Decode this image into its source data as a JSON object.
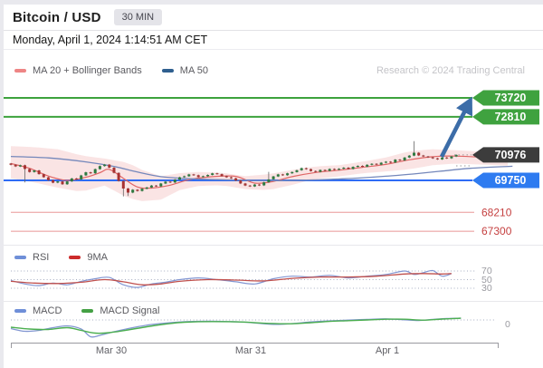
{
  "header": {
    "title": "Bitcoin / USD",
    "timeframe": "30 MIN"
  },
  "subheader": {
    "datetime": "Monday, April 1, 2024 1:14:51 AM CET"
  },
  "watermark": "Research © 2024 Trading Central",
  "colors": {
    "resistance_line": "#3da23d",
    "resistance_badge": "#3fa23f",
    "last_price_badge": "#3c3c3c",
    "support_active_line": "#2e6cf5",
    "support_active_badge": "#2e7bf0",
    "support_minor_line": "#efb3b3",
    "support_minor_text": "#c54040",
    "candle_up": "#2c7a3f",
    "candle_down": "#a83232",
    "ma20": "#e06666",
    "ma50": "#7588bb",
    "bollinger_fill": "#f6caca",
    "rsi_line": "#8296d2",
    "rsi_ma_line": "#c0504d",
    "macd_line": "#8296d2",
    "macd_signal_line": "#4caf50",
    "arrow": "#3c6da8"
  },
  "legends": {
    "main": [
      {
        "label": "MA 20 + Bollinger Bands",
        "color": "#ee8585"
      },
      {
        "label": "MA 50",
        "color": "#2f5f8f"
      }
    ],
    "rsi": [
      {
        "label": "RSI",
        "color": "#6f8fd8"
      },
      {
        "label": "9MA",
        "color": "#cc2b2b"
      }
    ],
    "macd": [
      {
        "label": "MACD",
        "color": "#6f8fd8"
      },
      {
        "label": "MACD Signal",
        "color": "#44a044"
      }
    ]
  },
  "chart_data": [
    {
      "type": "candlestick",
      "title": "Bitcoin / USD 30 MIN",
      "x_ticks": [
        "Mar 30",
        "Mar 31",
        "Apr 1"
      ],
      "y_range_visible": [
        67300,
        73720
      ],
      "levels": [
        {
          "value": 73720,
          "role": "resistance",
          "style": "green-badge"
        },
        {
          "value": 72810,
          "role": "resistance",
          "style": "green-badge"
        },
        {
          "value": 70976,
          "role": "last-price",
          "style": "dark-badge"
        },
        {
          "value": 69750,
          "role": "support",
          "style": "blue-badge"
        },
        {
          "value": 68210,
          "role": "support",
          "style": "red-text"
        },
        {
          "value": 67300,
          "role": "support",
          "style": "red-text"
        }
      ],
      "arrow": {
        "direction": "up",
        "from_price": 70976,
        "to_price": 73720
      },
      "open_first": 70560,
      "candles_close": [
        70500,
        70420,
        70480,
        70300,
        70150,
        70230,
        70050,
        69900,
        69760,
        69640,
        69700,
        69560,
        69700,
        69840,
        69800,
        69990,
        70140,
        70090,
        70290,
        70440,
        70510,
        70360,
        70110,
        69720,
        69360,
        69160,
        69300,
        69240,
        69350,
        69410,
        69500,
        69460,
        69600,
        69690,
        69650,
        69790,
        69900,
        69950,
        70040,
        70000,
        69910,
        69950,
        70010,
        70090,
        70050,
        69960,
        69900,
        69850,
        69740,
        69600,
        69500,
        69460,
        69550,
        69510,
        69660,
        69800,
        69940,
        70040,
        70000,
        70090,
        70150,
        70240,
        70340,
        70290,
        70200,
        70160,
        70250,
        70210,
        70300,
        70260,
        70310,
        70360,
        70300,
        70400,
        70450,
        70410,
        70500,
        70550,
        70510,
        70600,
        70650,
        70610,
        70750,
        70710,
        70850,
        70940,
        71080,
        70950,
        70900,
        70860,
        70810,
        70760,
        70850,
        70810,
        70900,
        70976
      ],
      "wick_overrides": {
        "3": {
          "low": 69650
        },
        "24": {
          "low": 68980
        },
        "25": {
          "low": 69000
        },
        "55": {
          "high": 70160
        },
        "86": {
          "high": 71640
        }
      },
      "ma50": [
        [
          0,
          70900
        ],
        [
          8,
          70830
        ],
        [
          16,
          70640
        ],
        [
          22,
          70420
        ],
        [
          27,
          70150
        ],
        [
          32,
          69930
        ],
        [
          38,
          69830
        ],
        [
          44,
          69790
        ],
        [
          50,
          69760
        ],
        [
          56,
          69740
        ],
        [
          62,
          69760
        ],
        [
          68,
          69800
        ],
        [
          74,
          69860
        ],
        [
          80,
          69950
        ],
        [
          86,
          70060
        ],
        [
          92,
          70200
        ],
        [
          98,
          70330
        ],
        [
          107,
          70430
        ]
      ],
      "ma20": [
        [
          0,
          70560
        ],
        [
          4,
          70330
        ],
        [
          8,
          69960
        ],
        [
          12,
          69750
        ],
        [
          16,
          69900
        ],
        [
          19,
          70120
        ],
        [
          21,
          70280
        ],
        [
          24,
          69850
        ],
        [
          27,
          69430
        ],
        [
          30,
          69380
        ],
        [
          34,
          69520
        ],
        [
          38,
          69780
        ],
        [
          43,
          69930
        ],
        [
          48,
          69940
        ],
        [
          52,
          69620
        ],
        [
          56,
          69700
        ],
        [
          60,
          69930
        ],
        [
          65,
          70130
        ],
        [
          70,
          70240
        ],
        [
          75,
          70380
        ],
        [
          80,
          70520
        ],
        [
          85,
          70740
        ],
        [
          90,
          70890
        ],
        [
          95,
          70920
        ],
        [
          107,
          70780
        ]
      ],
      "bb_upper": [
        [
          0,
          71400
        ],
        [
          5,
          71350
        ],
        [
          10,
          71250
        ],
        [
          15,
          70950
        ],
        [
          20,
          70800
        ],
        [
          25,
          70600
        ],
        [
          28,
          70250
        ],
        [
          32,
          69950
        ],
        [
          36,
          70100
        ],
        [
          40,
          70150
        ],
        [
          45,
          70120
        ],
        [
          50,
          69950
        ],
        [
          55,
          70050
        ],
        [
          60,
          70250
        ],
        [
          65,
          70420
        ],
        [
          70,
          70480
        ],
        [
          75,
          70650
        ],
        [
          80,
          70850
        ],
        [
          85,
          71150
        ],
        [
          90,
          71250
        ],
        [
          95,
          71200
        ],
        [
          107,
          71050
        ]
      ],
      "bb_lower": [
        [
          0,
          69850
        ],
        [
          5,
          69650
        ],
        [
          10,
          69400
        ],
        [
          15,
          69200
        ],
        [
          20,
          69500
        ],
        [
          25,
          68900
        ],
        [
          28,
          68750
        ],
        [
          32,
          68820
        ],
        [
          36,
          69280
        ],
        [
          40,
          69480
        ],
        [
          45,
          69520
        ],
        [
          50,
          69330
        ],
        [
          55,
          69280
        ],
        [
          60,
          69530
        ],
        [
          65,
          69830
        ],
        [
          70,
          69940
        ],
        [
          75,
          70090
        ],
        [
          80,
          70180
        ],
        [
          85,
          70280
        ],
        [
          90,
          70480
        ],
        [
          95,
          70560
        ],
        [
          107,
          70450
        ]
      ]
    },
    {
      "type": "line",
      "title": "RSI pane",
      "range": [
        0,
        100
      ],
      "gridlines": [
        70,
        50,
        30
      ],
      "gridline_labels": [
        "70",
        "50",
        "30"
      ],
      "series": [
        {
          "name": "RSI",
          "points": [
            [
              0,
              48
            ],
            [
              3,
              40
            ],
            [
              6,
              36
            ],
            [
              9,
              42
            ],
            [
              12,
              38
            ],
            [
              15,
              46
            ],
            [
              18,
              52
            ],
            [
              21,
              55
            ],
            [
              24,
              38
            ],
            [
              27,
              32
            ],
            [
              30,
              40
            ],
            [
              33,
              44
            ],
            [
              36,
              50
            ],
            [
              40,
              54
            ],
            [
              44,
              50
            ],
            [
              48,
              45
            ],
            [
              52,
              40
            ],
            [
              56,
              52
            ],
            [
              60,
              58
            ],
            [
              64,
              56
            ],
            [
              68,
              60
            ],
            [
              72,
              54
            ],
            [
              76,
              58
            ],
            [
              80,
              62
            ],
            [
              84,
              70
            ],
            [
              86,
              62
            ],
            [
              88,
              66
            ],
            [
              90,
              71
            ],
            [
              92,
              58
            ],
            [
              94,
              64
            ]
          ]
        },
        {
          "name": "9MA",
          "points": [
            [
              0,
              46
            ],
            [
              5,
              42
            ],
            [
              10,
              41
            ],
            [
              15,
              44
            ],
            [
              20,
              50
            ],
            [
              24,
              45
            ],
            [
              28,
              38
            ],
            [
              32,
              40
            ],
            [
              36,
              46
            ],
            [
              42,
              50
            ],
            [
              48,
              49
            ],
            [
              54,
              47
            ],
            [
              60,
              53
            ],
            [
              66,
              56
            ],
            [
              72,
              56
            ],
            [
              78,
              58
            ],
            [
              84,
              63
            ],
            [
              88,
              64
            ],
            [
              92,
              63
            ],
            [
              94,
              64
            ]
          ]
        }
      ]
    },
    {
      "type": "line",
      "title": "MACD pane",
      "zero_label": "0",
      "series": [
        {
          "name": "MACD",
          "points": [
            [
              0,
              -95
            ],
            [
              3,
              -125
            ],
            [
              6,
              -115
            ],
            [
              9,
              -85
            ],
            [
              12,
              -65
            ],
            [
              15,
              -100
            ],
            [
              17,
              -185
            ],
            [
              19,
              -170
            ],
            [
              22,
              -130
            ],
            [
              26,
              -85
            ],
            [
              30,
              -50
            ],
            [
              34,
              -30
            ],
            [
              38,
              -18
            ],
            [
              44,
              -15
            ],
            [
              50,
              -25
            ],
            [
              56,
              -48
            ],
            [
              60,
              -40
            ],
            [
              64,
              -22
            ],
            [
              68,
              -10
            ],
            [
              72,
              -2
            ],
            [
              76,
              6
            ],
            [
              80,
              12
            ],
            [
              84,
              2
            ],
            [
              87,
              -6
            ],
            [
              90,
              6
            ],
            [
              93,
              16
            ],
            [
              96,
              20
            ]
          ]
        },
        {
          "name": "MACD Signal",
          "points": [
            [
              0,
              -80
            ],
            [
              4,
              -100
            ],
            [
              8,
              -105
            ],
            [
              12,
              -85
            ],
            [
              15,
              -115
            ],
            [
              18,
              -145
            ],
            [
              21,
              -140
            ],
            [
              25,
              -110
            ],
            [
              29,
              -75
            ],
            [
              33,
              -45
            ],
            [
              37,
              -25
            ],
            [
              43,
              -18
            ],
            [
              49,
              -22
            ],
            [
              55,
              -38
            ],
            [
              60,
              -42
            ],
            [
              64,
              -30
            ],
            [
              68,
              -16
            ],
            [
              72,
              -8
            ],
            [
              76,
              0
            ],
            [
              80,
              8
            ],
            [
              84,
              8
            ],
            [
              88,
              -2
            ],
            [
              92,
              10
            ],
            [
              96,
              19
            ]
          ]
        }
      ]
    }
  ]
}
